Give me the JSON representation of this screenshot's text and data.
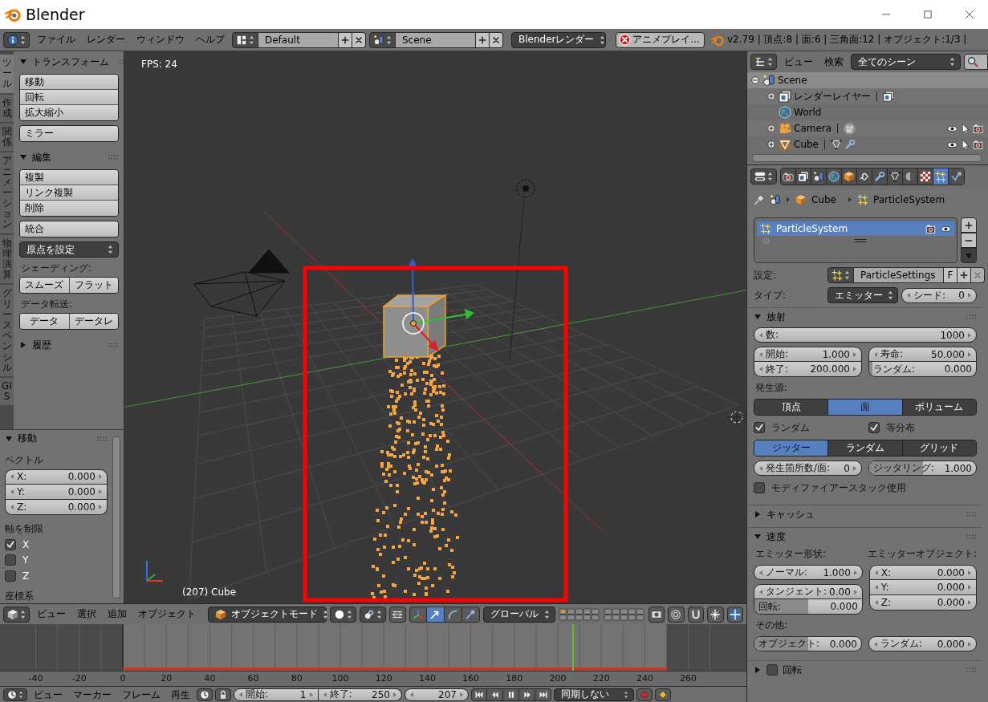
{
  "window": {
    "title": "Blender"
  },
  "info_header": {
    "menus": [
      "ファイル",
      "レンダー",
      "ウィンドウ",
      "ヘルプ"
    ],
    "screen_layout": "Default",
    "scene": "Scene",
    "render_engine": "Blenderレンダー",
    "playback_button": "アニメプレイ…",
    "stats": "v2.79 | 頂点:8 | 面:6 | 三角面:12 | オブジェクト:1/3 |"
  },
  "tool_tabs": [
    {
      "label": "ツール",
      "selected": true
    },
    {
      "label": "作成",
      "selected": false
    },
    {
      "label": "関係",
      "selected": false
    },
    {
      "label": "アニメーション",
      "selected": false
    },
    {
      "label": "物理演算",
      "selected": false
    },
    {
      "label": "グリースペンシル",
      "selected": false
    },
    {
      "label": "GIS",
      "selected": false
    }
  ],
  "tool_panels": [
    {
      "title": "トランスフォーム",
      "expanded": true,
      "items": [
        {
          "kind": "column",
          "buttons": [
            "移動",
            "回転",
            "拡大縮小"
          ]
        },
        {
          "kind": "column",
          "buttons": [
            "ミラー"
          ]
        }
      ]
    },
    {
      "title": "編集",
      "expanded": true,
      "items": [
        {
          "kind": "column",
          "buttons": [
            "複製",
            "リンク複製",
            "削除"
          ]
        },
        {
          "kind": "column",
          "buttons": [
            "統合"
          ]
        },
        {
          "kind": "dropdown",
          "label": "原点を設定"
        },
        {
          "kind": "label",
          "text": "シェーディング:"
        },
        {
          "kind": "row",
          "buttons": [
            "スムーズ",
            "フラット"
          ]
        },
        {
          "kind": "label",
          "text": "データ転送:"
        },
        {
          "kind": "row",
          "buttons": [
            "データ",
            "データレ"
          ]
        }
      ]
    },
    {
      "title": "履歴",
      "expanded": false
    }
  ],
  "operator_panel": {
    "title": "移動",
    "expanded": true,
    "vector_label": "ベクトル",
    "vector": [
      {
        "label": "X:",
        "value": "0.000"
      },
      {
        "label": "Y:",
        "value": "0.000"
      },
      {
        "label": "Z:",
        "value": "0.000"
      }
    ],
    "constraint_label": "軸を制限",
    "axes": [
      {
        "label": "X",
        "checked": true
      },
      {
        "label": "Y",
        "checked": false
      },
      {
        "label": "Z",
        "checked": false
      }
    ],
    "orientation_label": "座標系"
  },
  "viewport": {
    "fps": "FPS: 24",
    "object_info": "(207) Cube"
  },
  "viewport_header": {
    "menus": [
      "ビュー",
      "選択",
      "追加",
      "オブジェクト"
    ],
    "mode": "オブジェクトモード",
    "orientation": "グローバル"
  },
  "timeline": {
    "ticks": [
      "-40",
      "-20",
      "0",
      "20",
      "40",
      "60",
      "80",
      "100",
      "120",
      "140",
      "160",
      "180",
      "200",
      "220",
      "240",
      "260"
    ]
  },
  "timeline_header": {
    "menus": [
      "ビュー",
      "マーカー",
      "フレーム",
      "再生"
    ],
    "start": {
      "label": "開始:",
      "value": "1"
    },
    "end": {
      "label": "終了:",
      "value": "250"
    },
    "current": {
      "value": "207"
    },
    "sync": "同期しない"
  },
  "outliner": {
    "menus": [
      "ビュー",
      "検索"
    ],
    "filter": "全てのシーン",
    "tree": [
      {
        "label": "Scene",
        "kind": "scene",
        "expanded": true,
        "selected": true,
        "children": [
          {
            "label": "レンダーレイヤー",
            "kind": "render_layer",
            "expanded": false,
            "selected": false
          },
          {
            "label": "World",
            "kind": "world",
            "selected": false
          },
          {
            "label": "Camera",
            "kind": "camera",
            "expanded": false,
            "selected": false
          },
          {
            "label": "Cube",
            "kind": "mesh",
            "expanded": false,
            "selected": false
          }
        ]
      }
    ]
  },
  "properties": {
    "tabs": [
      {
        "kind": "render",
        "selected": false
      },
      {
        "kind": "render_layers",
        "selected": false
      },
      {
        "kind": "scene",
        "selected": false
      },
      {
        "kind": "world",
        "selected": false
      },
      {
        "kind": "object",
        "selected": false
      },
      {
        "kind": "constraints",
        "selected": false
      },
      {
        "kind": "modifiers",
        "selected": false
      },
      {
        "kind": "data",
        "selected": false
      },
      {
        "kind": "material",
        "selected": false
      },
      {
        "kind": "texture",
        "selected": false
      },
      {
        "kind": "particles",
        "selected": true
      },
      {
        "kind": "physics",
        "selected": false
      }
    ],
    "breadcrumb": [
      "Cube",
      "ParticleSystem"
    ],
    "systems": [
      {
        "name": "ParticleSystem",
        "selected": true
      }
    ],
    "settings": {
      "label": "設定:",
      "value": "ParticleSettings",
      "users": "F"
    },
    "type": {
      "label": "タイプ:",
      "value": "エミッター"
    },
    "seed": {
      "label": "シード:",
      "value": "0"
    },
    "emission": {
      "title": "放射",
      "expanded": true,
      "count": {
        "label": "数:",
        "value": "1000"
      },
      "start": {
        "label": "開始:",
        "value": "1.000"
      },
      "end": {
        "label": "終了:",
        "value": "200.000"
      },
      "lifetime": {
        "label": "寿命:",
        "value": "50.000"
      },
      "lifetime_random": {
        "label": "ランダム:",
        "value": "0.000",
        "level": 0
      },
      "source_label": "発生源:",
      "sources": [
        {
          "label": "頂点",
          "selected": false
        },
        {
          "label": "面",
          "selected": true
        },
        {
          "label": "ボリューム",
          "selected": false
        }
      ],
      "source_options": [
        {
          "label": "ランダム",
          "checked": true
        },
        {
          "label": "等分布",
          "checked": true
        }
      ],
      "distributions": [
        {
          "label": "ジッター",
          "selected": true
        },
        {
          "label": "ランダム",
          "selected": false
        },
        {
          "label": "グリッド",
          "selected": false
        }
      ],
      "per_face": {
        "label": "発生箇所数/面:",
        "value": "0"
      },
      "jittering": {
        "label": "ジッタリング:",
        "value": "1.000",
        "level": 0.5
      },
      "modifier_stack": {
        "label": "モディファイアースタック使用",
        "checked": false
      }
    },
    "cache": {
      "title": "キャッシュ",
      "expanded": false
    },
    "velocity": {
      "title": "速度",
      "expanded": true,
      "emitter_geometry_label": "エミッター形状:",
      "normal": {
        "label": "ノーマル:",
        "value": "1.000"
      },
      "tangent": {
        "label": "タンジェント:",
        "value": "0.00"
      },
      "tangent_phase": {
        "label": "回転:",
        "value": "0.000",
        "level": 0.5
      },
      "emitter_object_label": "エミッターオブジェクト:",
      "object_axes": [
        {
          "label": "X:",
          "value": "0.000"
        },
        {
          "label": "Y:",
          "value": "0.000"
        },
        {
          "label": "Z:",
          "value": "0.000"
        }
      ],
      "other_label": "その他:",
      "object": {
        "label": "オブジェクト:",
        "value": "0.000",
        "level": 0.5
      },
      "random": {
        "label": "ランダム:",
        "value": "0.000"
      }
    },
    "rotation": {
      "title": "回転",
      "expanded": false,
      "enabled": false
    }
  }
}
